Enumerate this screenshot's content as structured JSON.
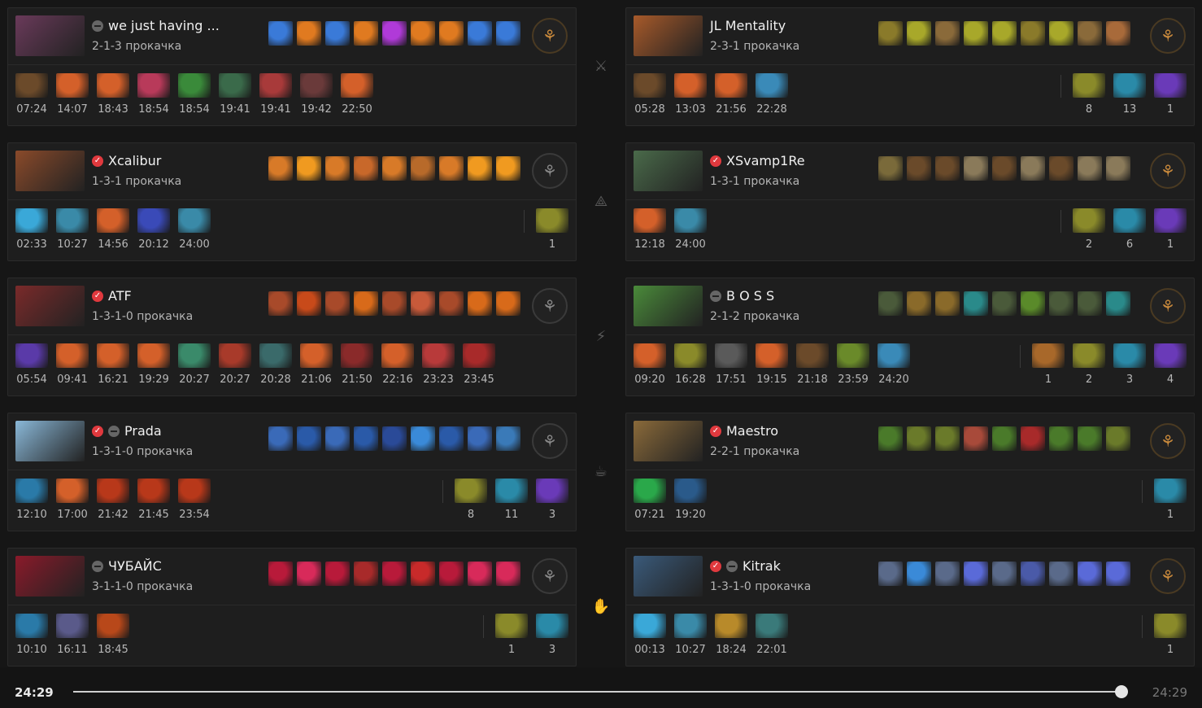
{
  "timeline": {
    "current": "24:29",
    "total": "24:29",
    "progress": 1.0
  },
  "roles": [
    "carry-icon",
    "mid-icon",
    "offlane-icon",
    "support-icon",
    "hard-support-icon"
  ],
  "radiant": [
    {
      "name": "we just having ...",
      "build": "2-1-3 прокачка",
      "verified": false,
      "anon": true,
      "avatar_color": "#6a3a5a",
      "skills": [
        "#3a7ad8",
        "#e07a20",
        "#3a7ad8",
        "#e07a20",
        "#b03ad8",
        "#e07a20",
        "#e07a20",
        "#3a7ad8",
        "#3a7ad8"
      ],
      "items": [
        {
          "time": "07:24",
          "color": "#6b4a2a"
        },
        {
          "time": "14:07",
          "color": "#d4602a"
        },
        {
          "time": "18:43",
          "color": "#d4602a"
        },
        {
          "time": "18:54",
          "color": "#b83a5a"
        },
        {
          "time": "18:54",
          "color": "#3a8a3a"
        },
        {
          "time": "19:41",
          "color": "#3a6a4a"
        },
        {
          "time": "19:41",
          "color": "#a83a3a"
        },
        {
          "time": "19:42",
          "color": "#6a3a3a"
        },
        {
          "time": "22:50",
          "color": "#d4602a"
        }
      ],
      "consumables": []
    },
    {
      "name": "Xcalibur",
      "build": "1-3-1 прокачка",
      "verified": true,
      "anon": false,
      "avatar_color": "#8a4a2a",
      "skills": [
        "#d87a28",
        "#f09a20",
        "#d87a28",
        "#c8682a",
        "#d87a28",
        "#b86a2a",
        "#d87a28",
        "#f09a20",
        "#f09a20"
      ],
      "items": [
        {
          "time": "02:33",
          "color": "#3aa8d8"
        },
        {
          "time": "10:27",
          "color": "#3a8aa8"
        },
        {
          "time": "14:56",
          "color": "#d4602a"
        },
        {
          "time": "20:12",
          "color": "#3a4ab8"
        },
        {
          "time": "24:00",
          "color": "#3a8aa8"
        }
      ],
      "consumables": [
        {
          "count": "1",
          "color": "#8a8a2a"
        }
      ]
    },
    {
      "name": "ATF",
      "build": "1-3-1-0 прокачка",
      "verified": true,
      "anon": false,
      "avatar_color": "#7a2a2a",
      "skills": [
        "#a84a2a",
        "#c84a1a",
        "#a84a2a",
        "#d86a1a",
        "#a84a2a",
        "#c85a3a",
        "#a84a2a",
        "#d86a1a",
        "#d86a1a"
      ],
      "items": [
        {
          "time": "05:54",
          "color": "#5a3aa8"
        },
        {
          "time": "09:41",
          "color": "#d4602a"
        },
        {
          "time": "16:21",
          "color": "#d4602a"
        },
        {
          "time": "19:29",
          "color": "#d4602a"
        },
        {
          "time": "20:27",
          "color": "#3a8a6a"
        },
        {
          "time": "20:27",
          "color": "#a83a2a"
        },
        {
          "time": "20:28",
          "color": "#3a6a6a"
        },
        {
          "time": "21:06",
          "color": "#d4602a"
        },
        {
          "time": "21:50",
          "color": "#8a2a2a"
        },
        {
          "time": "22:16",
          "color": "#d4602a"
        },
        {
          "time": "23:23",
          "color": "#b83a3a"
        },
        {
          "time": "23:45",
          "color": "#a82a2a"
        }
      ],
      "consumables": []
    },
    {
      "name": "Prada",
      "build": "1-3-1-0 прокачка",
      "verified": true,
      "anon": true,
      "avatar_color": "#8ab8d8",
      "skills": [
        "#3a6ab8",
        "#2a5aa8",
        "#3a6ab8",
        "#2a5aa8",
        "#2a4a98",
        "#3a8ad8",
        "#2a5aa8",
        "#3a6ab8",
        "#3a7ab8"
      ],
      "items": [
        {
          "time": "12:10",
          "color": "#2a7aa8"
        },
        {
          "time": "17:00",
          "color": "#d4602a"
        },
        {
          "time": "21:42",
          "color": "#b8381a"
        },
        {
          "time": "21:45",
          "color": "#b8381a"
        },
        {
          "time": "23:54",
          "color": "#b8381a"
        }
      ],
      "consumables": [
        {
          "count": "8",
          "color": "#8a8a2a"
        },
        {
          "count": "11",
          "color": "#2a8aa8"
        },
        {
          "count": "3",
          "color": "#6a3ab8"
        }
      ]
    },
    {
      "name": "ЧУБАЙС",
      "build": "3-1-1-0 прокачка",
      "verified": false,
      "anon": true,
      "avatar_color": "#8a1a2a",
      "skills": [
        "#b81a3a",
        "#d82a5a",
        "#b81a3a",
        "#a82a2a",
        "#b81a3a",
        "#c82a2a",
        "#b81a3a",
        "#d82a5a",
        "#d82a5a"
      ],
      "items": [
        {
          "time": "10:10",
          "color": "#2a7aa8"
        },
        {
          "time": "16:11",
          "color": "#5a5a8a"
        },
        {
          "time": "18:45",
          "color": "#b8481a"
        }
      ],
      "consumables": [
        {
          "count": "1",
          "color": "#8a8a2a"
        },
        {
          "count": "3",
          "color": "#2a8aa8"
        }
      ]
    }
  ],
  "dire": [
    {
      "name": "JL Mentality",
      "build": "2-3-1 прокачка",
      "verified": false,
      "anon": false,
      "avatar_color": "#a85a2a",
      "skills": [
        "#8a7a2a",
        "#a8a82a",
        "#8a6a3a",
        "#a8a82a",
        "#a8a82a",
        "#8a7a2a",
        "#a8a82a",
        "#8a6a3a",
        "#a86a3a"
      ],
      "items": [
        {
          "time": "05:28",
          "color": "#6b4a2a"
        },
        {
          "time": "13:03",
          "color": "#d4602a"
        },
        {
          "time": "21:56",
          "color": "#d4602a"
        },
        {
          "time": "22:28",
          "color": "#3a8ab8"
        }
      ],
      "consumables": [
        {
          "count": "8",
          "color": "#8a8a2a"
        },
        {
          "count": "13",
          "color": "#2a8aa8"
        },
        {
          "count": "1",
          "color": "#6a3ab8"
        }
      ]
    },
    {
      "name": "XSvamp1Re",
      "build": "1-3-1 прокачка",
      "verified": true,
      "anon": false,
      "avatar_color": "#4a6a4a",
      "skills": [
        "#7a6a3a",
        "#6a4a2a",
        "#6a4a2a",
        "#8a7a5a",
        "#6a4a2a",
        "#8a7a5a",
        "#6a4a2a",
        "#8a7a5a",
        "#8a7a5a"
      ],
      "items": [
        {
          "time": "12:18",
          "color": "#d4602a"
        },
        {
          "time": "24:00",
          "color": "#3a8aa8"
        }
      ],
      "consumables": [
        {
          "count": "2",
          "color": "#8a8a2a"
        },
        {
          "count": "6",
          "color": "#2a8aa8"
        },
        {
          "count": "1",
          "color": "#6a3ab8"
        }
      ]
    },
    {
      "name": "B O S S",
      "build": "2-1-2 прокачка",
      "verified": false,
      "anon": true,
      "avatar_color": "#4a8a3a",
      "skills": [
        "#4a5a3a",
        "#8a6a2a",
        "#8a6a2a",
        "#2a8a8a",
        "#4a5a3a",
        "#5a8a2a",
        "#4a5a3a",
        "#4a5a3a",
        "#2a8a8a"
      ],
      "items": [
        {
          "time": "09:20",
          "color": "#d4602a"
        },
        {
          "time": "16:28",
          "color": "#8a8a2a"
        },
        {
          "time": "17:51",
          "color": "#5a5a5a"
        },
        {
          "time": "19:15",
          "color": "#d4602a"
        },
        {
          "time": "21:18",
          "color": "#6b4a2a"
        },
        {
          "time": "23:59",
          "color": "#6a8a2a"
        },
        {
          "time": "24:20",
          "color": "#3a8ab8"
        }
      ],
      "consumables": [
        {
          "count": "1",
          "color": "#a8682a"
        },
        {
          "count": "2",
          "color": "#8a8a2a"
        },
        {
          "count": "3",
          "color": "#2a8aa8"
        },
        {
          "count": "4",
          "color": "#6a3ab8"
        }
      ]
    },
    {
      "name": "Maestro",
      "build": "2-2-1 прокачка",
      "verified": true,
      "anon": false,
      "avatar_color": "#8a6a3a",
      "skills": [
        "#4a7a2a",
        "#6a7a2a",
        "#6a7a2a",
        "#a84a3a",
        "#4a7a2a",
        "#a82a2a",
        "#4a7a2a",
        "#4a7a2a",
        "#6a7a2a"
      ],
      "items": [
        {
          "time": "07:21",
          "color": "#2aa84a"
        },
        {
          "time": "19:20",
          "color": "#2a5a8a"
        }
      ],
      "consumables": [
        {
          "count": "1",
          "color": "#2a8aa8"
        }
      ]
    },
    {
      "name": "Kitrak",
      "build": "1-3-1-0 прокачка",
      "verified": true,
      "anon": true,
      "avatar_color": "#3a5a7a",
      "skills": [
        "#5a6a8a",
        "#3a8ad8",
        "#5a6a8a",
        "#5a6ad8",
        "#5a6a8a",
        "#4a5aa8",
        "#5a6a8a",
        "#5a6ad8",
        "#5a6ad8"
      ],
      "items": [
        {
          "time": "00:13",
          "color": "#3aa8d8"
        },
        {
          "time": "10:27",
          "color": "#3a8aa8"
        },
        {
          "time": "18:24",
          "color": "#b88a2a"
        },
        {
          "time": "22:01",
          "color": "#3a7a7a"
        }
      ],
      "consumables": [
        {
          "count": "1",
          "color": "#8a8a2a"
        }
      ]
    }
  ]
}
